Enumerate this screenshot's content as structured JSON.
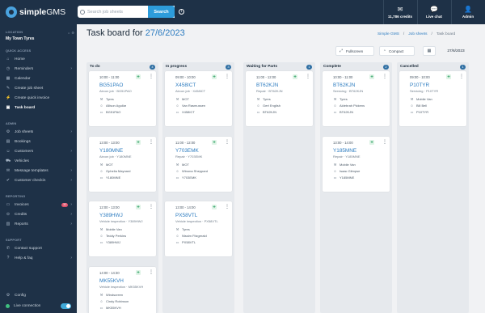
{
  "app": {
    "logo_bold": "simple",
    "logo_thin": "GMS"
  },
  "search": {
    "placeholder": "Search job sheets",
    "button_label": "Search"
  },
  "topbar": {
    "credits": {
      "glyph": "✉",
      "label": "11,786 credits"
    },
    "live_chat": {
      "glyph": "💬",
      "label": "Live chat"
    },
    "admin": {
      "glyph": "👤",
      "label": "Admin"
    }
  },
  "sidebar": {
    "location_heading": "LOCATION",
    "location_name": "My Town Tyres",
    "location_controls": "⇔ ⚙",
    "quick_access_heading": "QUICK ACCESS",
    "admin_heading": "ADMIN",
    "reporting_heading": "REPORTING",
    "support_heading": "SUPPORT",
    "items": [
      {
        "label": "Home",
        "icon": "⌂"
      },
      {
        "label": "Reminders",
        "icon": "◷"
      },
      {
        "label": "Calendar",
        "icon": "▦"
      },
      {
        "label": "Create job sheet",
        "icon": "✎"
      },
      {
        "label": "Create quick invoice",
        "icon": "⚡"
      },
      {
        "label": "Task board",
        "icon": "▣"
      },
      {
        "label": "Job sheets",
        "icon": "⚙"
      },
      {
        "label": "Bookings",
        "icon": "▤"
      },
      {
        "label": "Customers",
        "icon": "☺"
      },
      {
        "label": "Vehicles",
        "icon": "⛟"
      },
      {
        "label": "Message templates",
        "icon": "✉"
      },
      {
        "label": "Customer checkin",
        "icon": "✔"
      },
      {
        "label": "Invoices",
        "icon": "▭",
        "badge": "32"
      },
      {
        "label": "Credits",
        "icon": "⊝"
      },
      {
        "label": "Reports",
        "icon": "▥"
      },
      {
        "label": "Contact support",
        "icon": "✆"
      },
      {
        "label": "Help & faq",
        "icon": "?"
      },
      {
        "label": "Config",
        "icon": "⚙"
      },
      {
        "label": "Live connection",
        "icon": ""
      }
    ]
  },
  "page": {
    "title_prefix": "Task board for",
    "title_date": "27/6/2023",
    "breadcrumb": [
      "Simple GMS",
      "/",
      "Job sheets",
      "/",
      "Task board"
    ],
    "fullscreen_label": "Fullscreen",
    "compact_label": "Compact",
    "date_value": "27/6/2023"
  },
  "columns": [
    {
      "title": "To do",
      "count": "4",
      "cards": [
        {
          "time": "10:00 - 11:00",
          "reg": "BG51PAO",
          "sub": "Aircon job · BG51PAO",
          "service": "Tyres",
          "person": "Allison Aguilar",
          "plate": "BG51PAO"
        },
        {
          "time": "13:00 - 13:00",
          "reg": "Y180MNE",
          "sub": "Aircon job · Y180MNE",
          "service": "MOT",
          "person": "Ophelia Maynard",
          "plate": "Y180MNE"
        },
        {
          "time": "12:00 - 13:00",
          "reg": "Y389HWJ",
          "sub": "Vehicle inspection · Y389HWJ",
          "service": "Mobile Van",
          "person": "Teddy Perkins",
          "plate": "Y389HWJ"
        },
        {
          "time": "14:00 - 14:30",
          "reg": "MK55KVH",
          "sub": "Vehicle inspection · MK55KVH",
          "service": "Windscreen",
          "person": "Cindy Robinson",
          "plate": "MK55KVH"
        }
      ]
    },
    {
      "title": "In progress",
      "count": "3",
      "cards": [
        {
          "time": "09:00 - 10:00",
          "reg": "X458ICT",
          "sub": "Aircon job · X458ICT",
          "service": "MOT",
          "person": "Van Rasmussen",
          "plate": "X458ICT"
        },
        {
          "time": "11:00 - 12:00",
          "reg": "Y703EMK",
          "sub": "Repair · Y703EMK",
          "service": "MOT",
          "person": "Winona Sheppard",
          "plate": "Y703EMK"
        },
        {
          "time": "13:00 - 14:00",
          "reg": "PX58VTL",
          "sub": "Vehicle inspection · PX58VTL",
          "service": "Tyres",
          "person": "Nissim Fitzgerald",
          "plate": "PX58VTL"
        }
      ]
    },
    {
      "title": "Waiting for Parts",
      "count": "1",
      "cards": [
        {
          "time": "11:00 - 12:00",
          "reg": "BT62KJN",
          "sub": "Repair · BT62KJN",
          "service": "Tyres",
          "person": "Gert English",
          "plate": "BT62KJN"
        }
      ]
    },
    {
      "title": "Complete",
      "count": "2",
      "cards": [
        {
          "time": "10:00 - 11:00",
          "reg": "BT62KJN",
          "sub": "Servicing · BT62KJN",
          "service": "Tyres",
          "person": "Aldebrah Pickens",
          "plate": "BT62KJN"
        },
        {
          "time": "13:00 - 14:00",
          "reg": "Y185MNE",
          "sub": "Repair · Y185MNE",
          "service": "Mobile Van",
          "person": "Isaac Glimpse",
          "plate": "Y185MNE"
        }
      ]
    },
    {
      "title": "Cancelled",
      "count": "1",
      "cards": [
        {
          "time": "09:00 - 10:00",
          "reg": "P10TYR",
          "sub": "Servicing · P10TYR",
          "service": "Mobile Van",
          "person": "Bill Bell",
          "plate": "P10TYR"
        }
      ]
    }
  ]
}
